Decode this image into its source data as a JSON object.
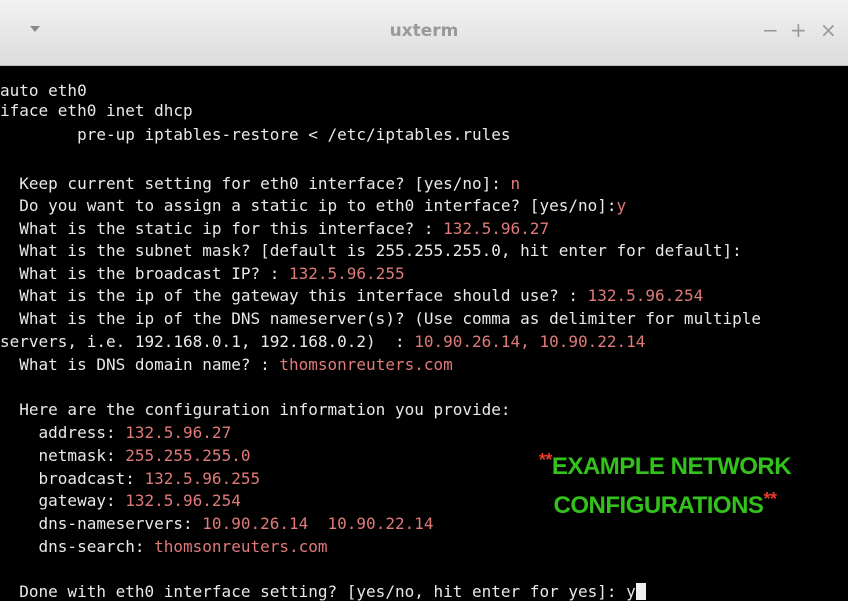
{
  "window": {
    "title": "uxterm",
    "menu_icon": "chevron-down-icon",
    "minimize_label": "−",
    "maximize_label": "+",
    "close_label": "×"
  },
  "terminal": {
    "lines": [
      {
        "text": "auto eth0",
        "value": ""
      },
      {
        "text": "iface eth0 inet dhcp",
        "value": ""
      },
      {
        "text": "        pre-up iptables-restore < /etc/iptables.rules",
        "value": ""
      },
      {
        "text": "",
        "value": ""
      },
      {
        "text": "  Keep current setting for eth0 interface? [yes/no]: ",
        "value": "n"
      },
      {
        "text": "  Do you want to assign a static ip to eth0 interface? [yes/no]:",
        "value": "y"
      },
      {
        "text": "  What is the static ip for this interface? : ",
        "value": "132.5.96.27"
      },
      {
        "text": "  What is the subnet mask? [default is 255.255.255.0, hit enter for default]:",
        "value": ""
      },
      {
        "text": "  What is the broadcast IP? : ",
        "value": "132.5.96.255"
      },
      {
        "text": "  What is the ip of the gateway this interface should use? : ",
        "value": "132.5.96.254"
      },
      {
        "text": "  What is the ip of the DNS nameserver(s)? (Use comma as delimiter for multiple",
        "value": ""
      },
      {
        "text": "servers, i.e. 192.168.0.1, 192.168.0.2)  : ",
        "value": "10.90.26.14, 10.90.22.14"
      },
      {
        "text": "  What is DNS domain name? : ",
        "value": "thomsonreuters.com"
      },
      {
        "text": "",
        "value": ""
      },
      {
        "text": "  Here are the configuration information you provide:",
        "value": ""
      },
      {
        "text": "    address: ",
        "value": "132.5.96.27"
      },
      {
        "text": "    netmask: ",
        "value": "255.255.255.0"
      },
      {
        "text": "    broadcast: ",
        "value": "132.5.96.255"
      },
      {
        "text": "    gateway: ",
        "value": "132.5.96.254"
      },
      {
        "text": "    dns-nameservers: ",
        "value": "10.90.26.14  10.90.22.14"
      },
      {
        "text": "    dns-search: ",
        "value": "thomsonreuters.com"
      },
      {
        "text": "",
        "value": ""
      },
      {
        "text": "  Done with eth0 interface setting? [yes/no, hit enter for yes]: ",
        "value": "y"
      }
    ]
  },
  "annotation": {
    "line1_stars": "**",
    "line1_text": "EXAMPLE NETWORK",
    "line2_text": "CONFIGURATIONS",
    "line2_stars": "**",
    "text_color": "#33c11b",
    "star_color": "#e63a2c"
  },
  "colors": {
    "terminal_bg": "#000000",
    "terminal_fg": "#e9e9e9",
    "value_fg": "#e07a79"
  }
}
